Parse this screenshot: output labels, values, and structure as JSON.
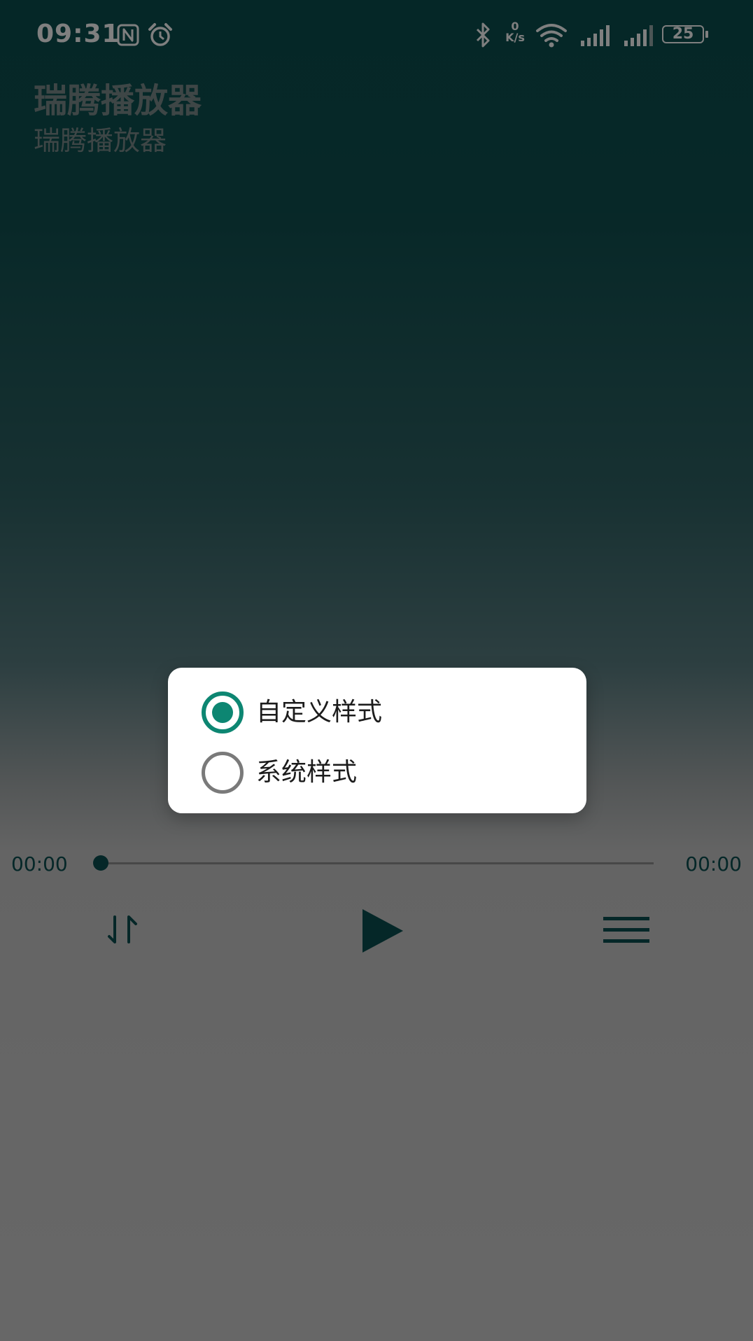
{
  "status_bar": {
    "time": "09:31",
    "net_speed_value": "0",
    "net_speed_unit": "K/s",
    "battery_level": "25",
    "icons": [
      "nfc-icon",
      "alarm-icon",
      "bluetooth-icon",
      "wifi-icon",
      "signal-icon",
      "signal-icon",
      "battery-icon"
    ]
  },
  "player": {
    "title": "瑞腾播放器",
    "artist": "瑞腾播放器",
    "current_time": "00:00",
    "total_time": "00:00",
    "progress": 0,
    "accent_color": "#0a4f50",
    "controls": [
      "play-mode-icon",
      "play-icon",
      "playlist-icon"
    ]
  },
  "dialog": {
    "options": [
      {
        "label": "自定义样式",
        "selected": true
      },
      {
        "label": "系统样式",
        "selected": false
      }
    ],
    "radio_color": "#0d8672"
  }
}
